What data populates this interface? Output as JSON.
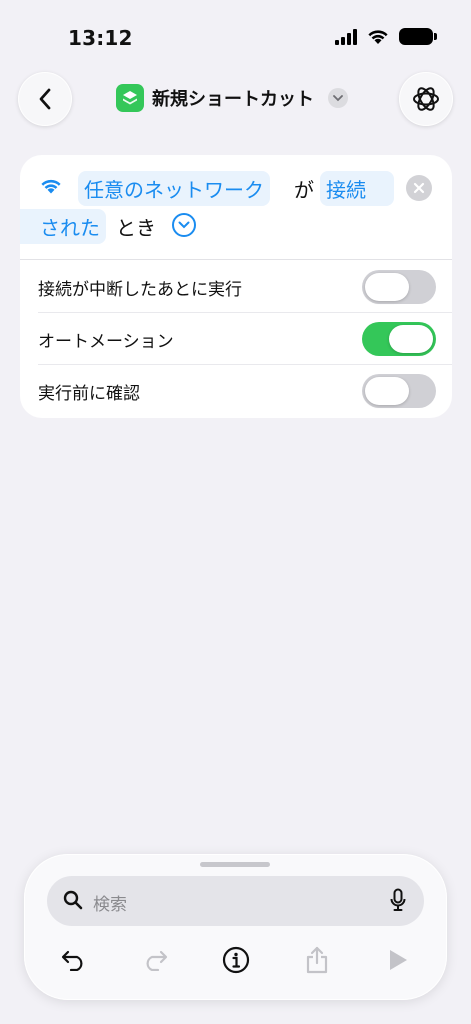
{
  "status": {
    "time": "13:12"
  },
  "nav": {
    "title": "新規ショートカット"
  },
  "trigger": {
    "network": "任意のネットワーク",
    "particle": "が",
    "state_part1": "接続",
    "state_part2": "された",
    "when": "とき"
  },
  "options": [
    {
      "label": "接続が中断したあとに実行",
      "enabled": false
    },
    {
      "label": "オートメーション",
      "enabled": true
    },
    {
      "label": "実行前に確認",
      "enabled": false
    }
  ],
  "toolbar": {
    "search_placeholder": "検索"
  },
  "colors": {
    "accent": "#1a8cf0",
    "toggle_on": "#34c759",
    "app_icon": "#34c759",
    "background": "#f2f1f6"
  }
}
